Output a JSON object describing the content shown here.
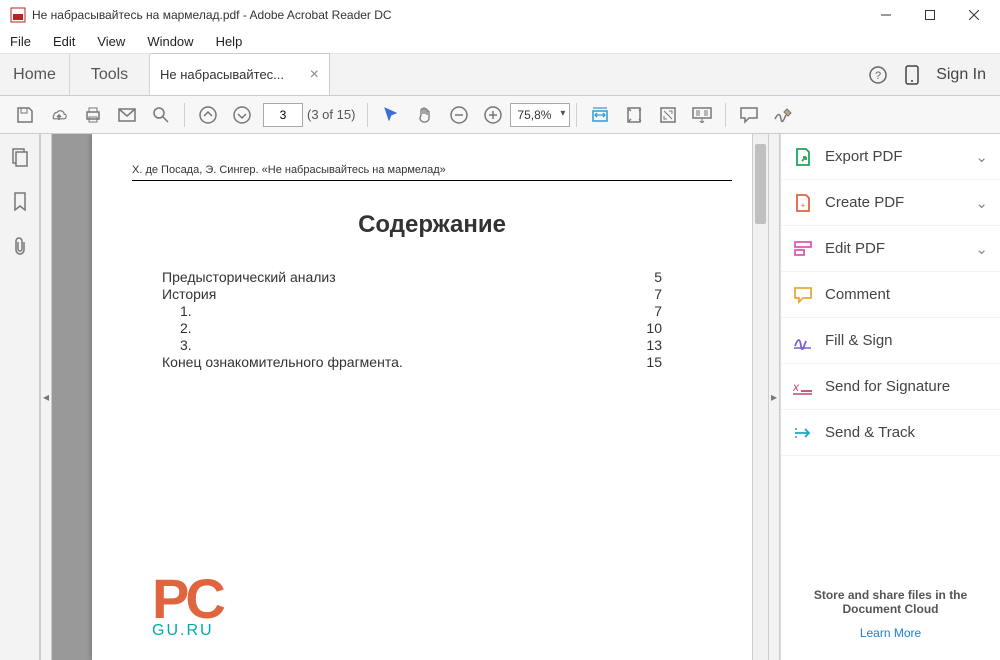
{
  "window": {
    "title": "Не набрасывайтесь на мармелад.pdf - Adobe Acrobat Reader DC"
  },
  "menu": {
    "file": "File",
    "edit": "Edit",
    "view": "View",
    "window": "Window",
    "help": "Help"
  },
  "tabs": {
    "home": "Home",
    "tools": "Tools",
    "doc": "Не набрасывайтес...",
    "signin": "Sign In"
  },
  "toolbar": {
    "page_current": "3",
    "page_total": "(3 of 15)",
    "zoom": "75,8%"
  },
  "document": {
    "header": "Х. де Посада, Э. Сингер. «Не набрасывайтесь на мармелад»",
    "toc_title": "Содержание",
    "toc": [
      {
        "label": "Предысторический анализ",
        "page": "5",
        "indent": 1
      },
      {
        "label": "История",
        "page": "7",
        "indent": 1
      },
      {
        "label": "1.",
        "page": "7",
        "indent": 2
      },
      {
        "label": "2.",
        "page": "10",
        "indent": 2
      },
      {
        "label": "3.",
        "page": "13",
        "indent": 2
      },
      {
        "label": "Конец ознакомительного фрагмента.",
        "page": "15",
        "indent": 1
      }
    ],
    "watermark": {
      "top": "PC",
      "bottom": "GU.RU"
    }
  },
  "rightpanel": {
    "export": "Export PDF",
    "create": "Create PDF",
    "edit": "Edit PDF",
    "comment": "Comment",
    "fillsign": "Fill & Sign",
    "signature": "Send for Signature",
    "track": "Send & Track",
    "footer_text": "Store and share files in the Document Cloud",
    "footer_link": "Learn More"
  }
}
